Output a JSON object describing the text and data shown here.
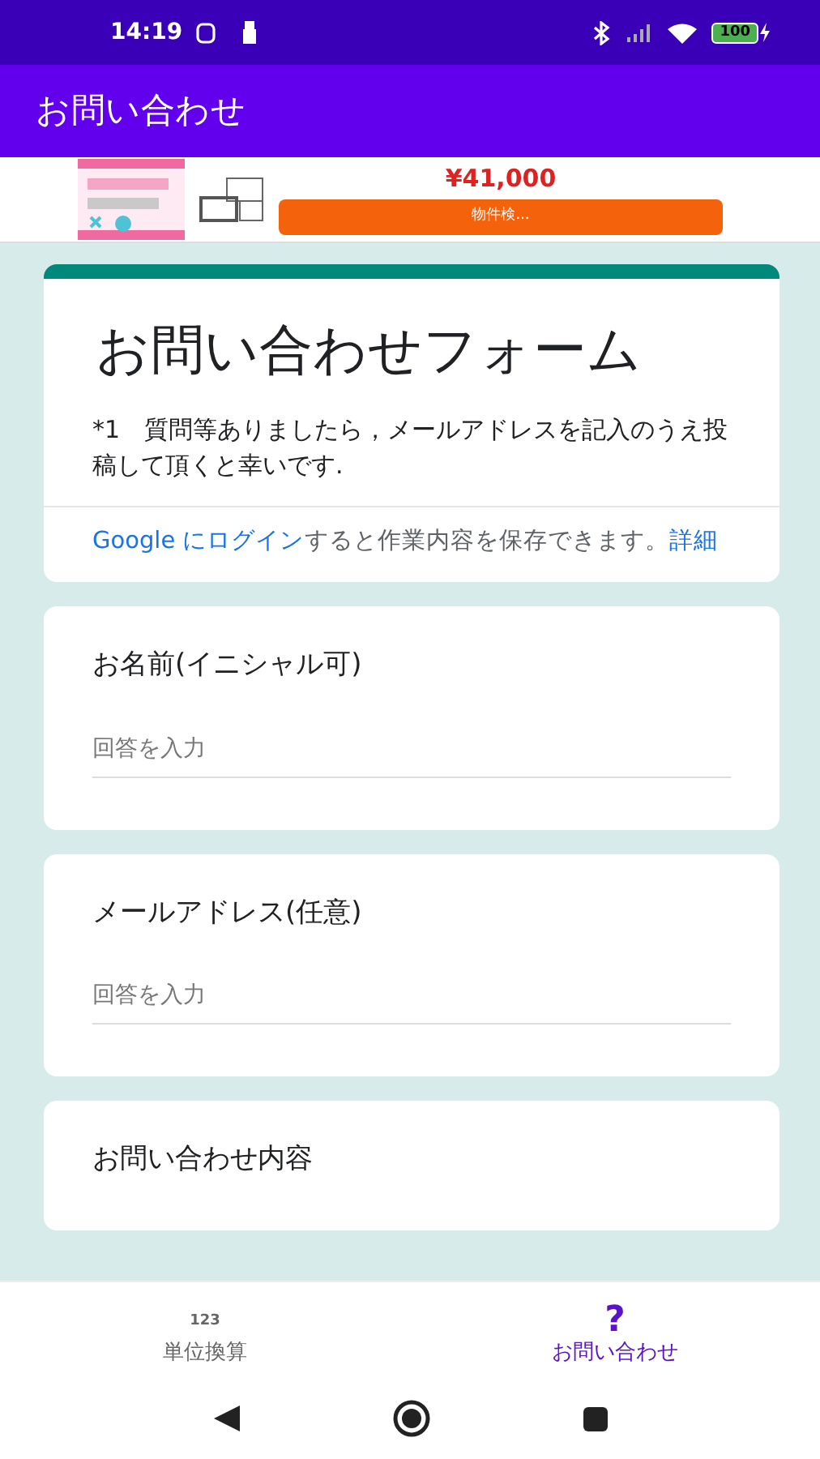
{
  "status_bar": {
    "time": "14:19",
    "battery": "100"
  },
  "app_bar": {
    "title": "お問い合わせ"
  },
  "ad": {
    "kind": "picture",
    "price": "¥41,000",
    "button": "物件検..."
  },
  "form": {
    "title": "お問い合わせフォーム",
    "description": "*1　質問等ありましたら，メールアドレスを記入のうえ投稿して頂くと幸いです.",
    "login_link": "Google にログイン",
    "login_text": "すると作業内容を保存できます。",
    "details_link": "詳細",
    "questions": [
      {
        "label": "お名前(イニシャル可)",
        "placeholder": "回答を入力"
      },
      {
        "label": "メールアドレス(任意)",
        "placeholder": "回答を入力"
      },
      {
        "label": "お問い合わせ内容"
      }
    ]
  },
  "bottom_nav": [
    {
      "icon": "123",
      "label": "単位換算",
      "selected": false
    },
    {
      "icon": "?",
      "label": "お問い合わせ",
      "selected": true
    }
  ]
}
